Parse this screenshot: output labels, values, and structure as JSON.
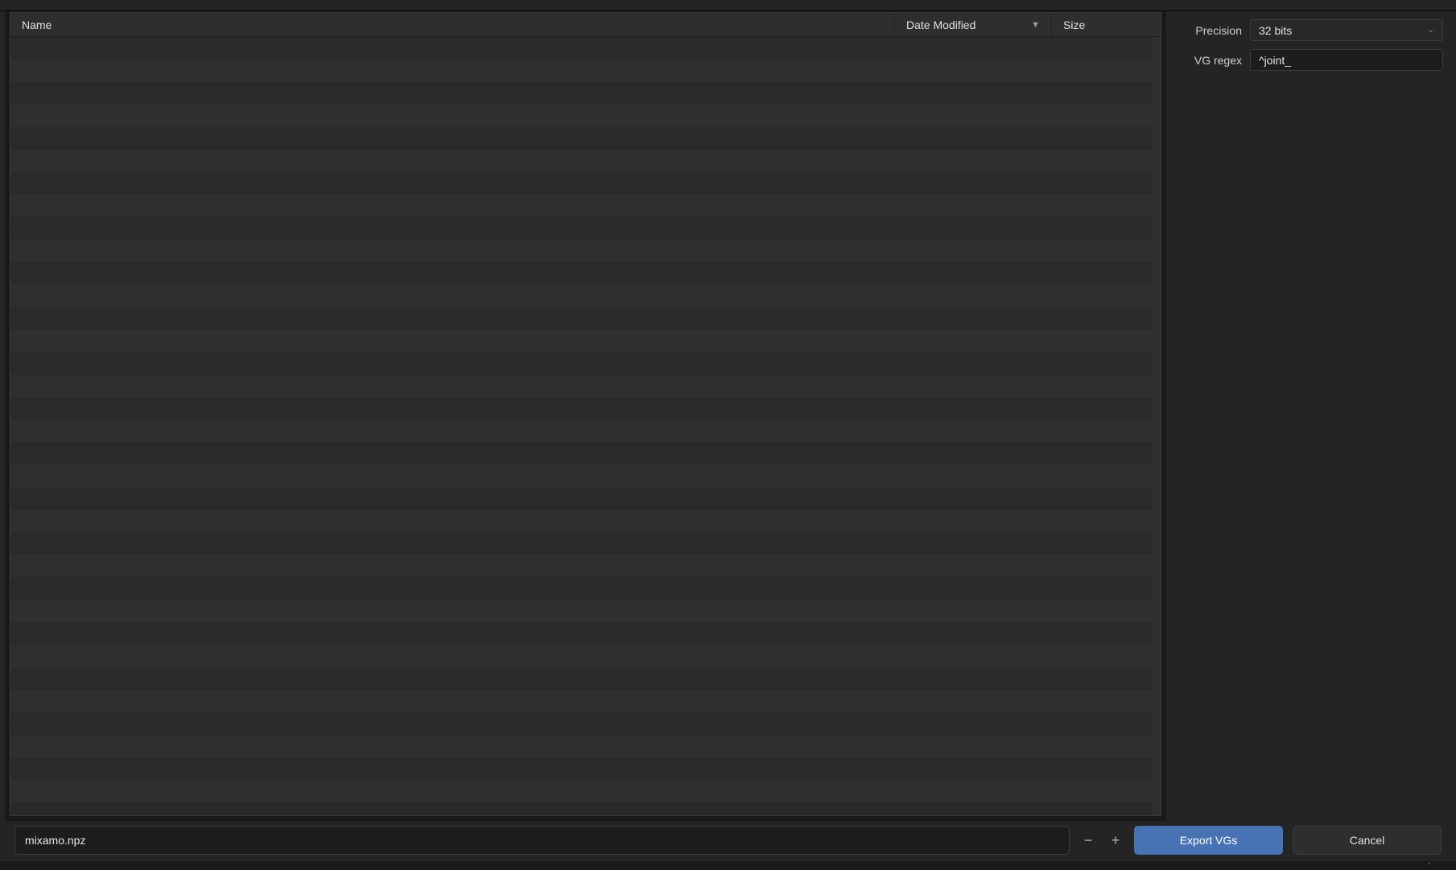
{
  "columns": {
    "name": "Name",
    "date": "Date Modified",
    "size": "Size",
    "sort_indicator": "▼"
  },
  "sidebar": {
    "precision": {
      "label": "Precision",
      "value": "32 bits"
    },
    "vg_regex": {
      "label": "VG regex",
      "value": "^joint_"
    }
  },
  "footer": {
    "filename": "mixamo.npz",
    "export_label": "Export VGs",
    "cancel_label": "Cancel"
  },
  "file_rows": 36
}
